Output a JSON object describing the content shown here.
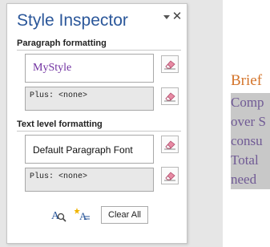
{
  "panel": {
    "title": "Style Inspector",
    "paragraph_section_label": "Paragraph formatting",
    "paragraph_style": "MyStyle",
    "paragraph_plus": "Plus: <none>",
    "text_section_label": "Text level formatting",
    "text_style": "Default Paragraph Font",
    "text_plus": "Plus: <none>",
    "clear_all_label": "Clear All"
  },
  "document": {
    "heading": "Brief",
    "lines": [
      "Comp",
      "over S",
      "consu",
      "Total",
      "need"
    ]
  },
  "colors": {
    "title": "#2b579a",
    "paragraph_style_text": "#7030a0",
    "doc_heading": "#d4742a",
    "doc_body_text": "#705a95",
    "doc_highlight": "#c8c8c8"
  },
  "icons": {
    "pane_options": "dropdown-arrow-icon",
    "close": "close-icon",
    "clear_paragraph_style": "eraser-icon",
    "clear_paragraph_formatting": "eraser-icon",
    "clear_character_style": "eraser-icon",
    "clear_character_formatting": "eraser-icon",
    "reveal_formatting": "reveal-formatting-icon",
    "new_style": "new-style-icon"
  }
}
